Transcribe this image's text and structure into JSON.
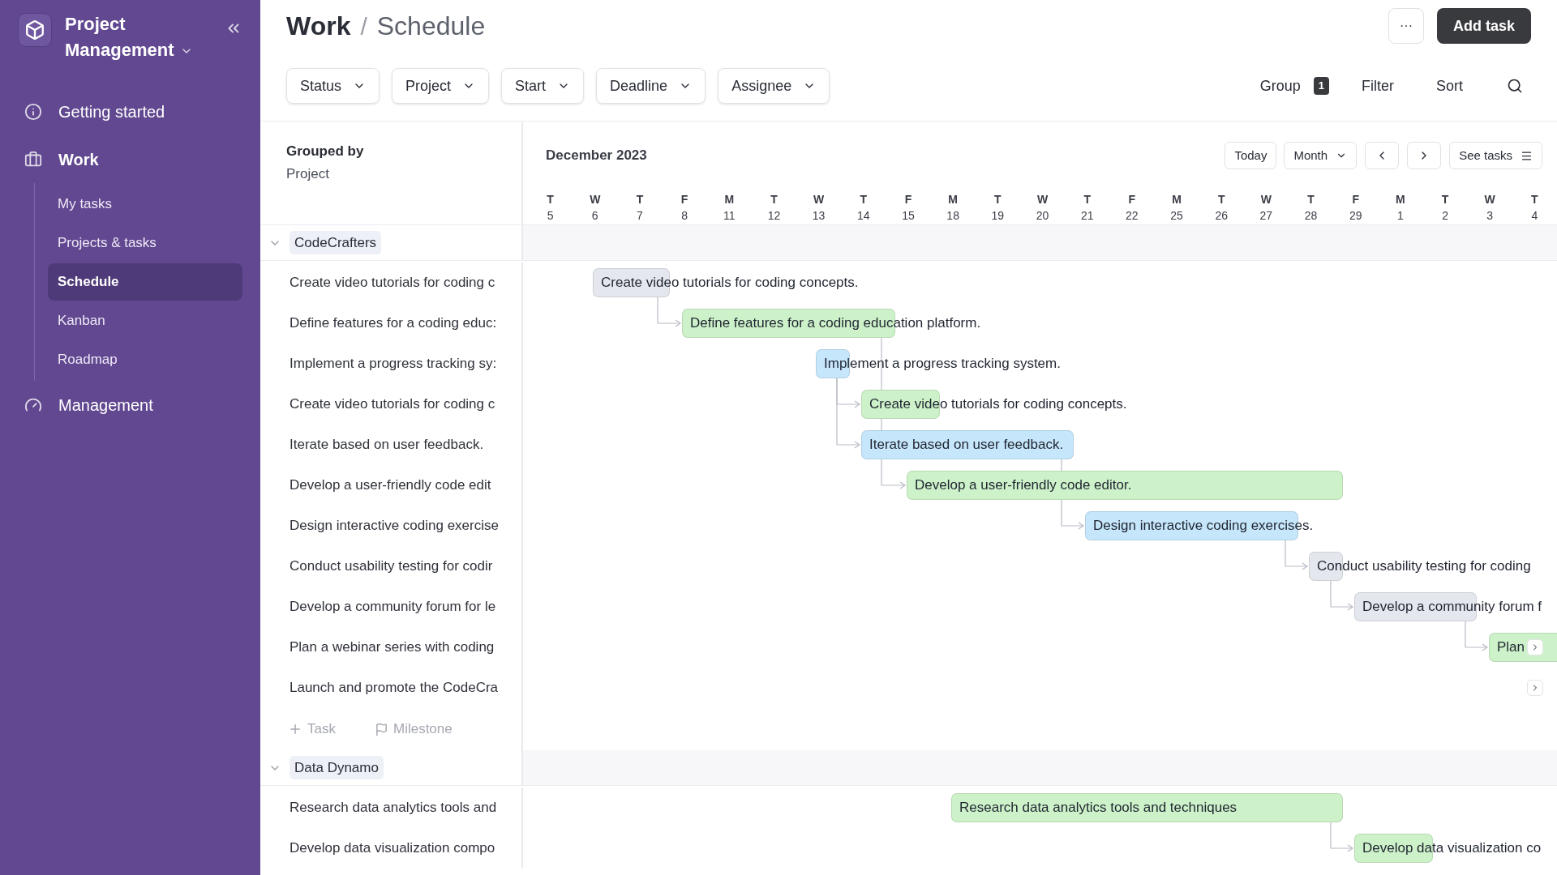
{
  "sidebar": {
    "workspace": "Project Management",
    "items": [
      {
        "label": "Getting started",
        "selected": false
      },
      {
        "label": "Work",
        "selected": false,
        "children": [
          {
            "label": "My tasks",
            "selected": false
          },
          {
            "label": "Projects & tasks",
            "selected": false
          },
          {
            "label": "Schedule",
            "selected": true
          },
          {
            "label": "Kanban",
            "selected": false
          },
          {
            "label": "Roadmap",
            "selected": false
          }
        ]
      },
      {
        "label": "Management",
        "selected": false
      }
    ]
  },
  "header": {
    "section": "Work",
    "separator": "/",
    "page": "Schedule",
    "more_button": "···",
    "add_button": "Add task"
  },
  "filters": [
    "Status",
    "Project",
    "Start",
    "Deadline",
    "Assignee"
  ],
  "toolbar": {
    "group_label": "Group",
    "group_count": "1",
    "filter": "Filter",
    "sort": "Sort"
  },
  "grouping": {
    "title": "Grouped by",
    "value": "Project"
  },
  "timeline": {
    "month": "December 2023",
    "today": "Today",
    "view": "Month",
    "see_tasks": "See tasks",
    "days": [
      {
        "weekday": "T",
        "date": "5"
      },
      {
        "weekday": "W",
        "date": "6"
      },
      {
        "weekday": "T",
        "date": "7"
      },
      {
        "weekday": "F",
        "date": "8"
      },
      {
        "weekday": "M",
        "date": "11"
      },
      {
        "weekday": "T",
        "date": "12"
      },
      {
        "weekday": "W",
        "date": "13"
      },
      {
        "weekday": "T",
        "date": "14"
      },
      {
        "weekday": "F",
        "date": "15"
      },
      {
        "weekday": "M",
        "date": "18"
      },
      {
        "weekday": "T",
        "date": "19"
      },
      {
        "weekday": "W",
        "date": "20"
      },
      {
        "weekday": "T",
        "date": "21"
      },
      {
        "weekday": "F",
        "date": "22"
      },
      {
        "weekday": "M",
        "date": "25"
      },
      {
        "weekday": "T",
        "date": "26"
      },
      {
        "weekday": "W",
        "date": "27"
      },
      {
        "weekday": "T",
        "date": "28"
      },
      {
        "weekday": "F",
        "date": "29"
      },
      {
        "weekday": "M",
        "date": "1"
      },
      {
        "weekday": "T",
        "date": "2"
      },
      {
        "weekday": "W",
        "date": "3"
      },
      {
        "weekday": "T",
        "date": "4"
      }
    ]
  },
  "groups": [
    {
      "name": "CodeCrafters",
      "expanded": true,
      "add_task": "Task",
      "add_milestone": "Milestone",
      "tasks": [
        {
          "name": "Create video tutorials for coding c",
          "bar": "Create video tutorials for coding concepts.",
          "color": "#e5e7ee",
          "more_arrow": false
        },
        {
          "name": "Define features for a coding educ:",
          "bar": "Define features for a coding education platform.",
          "color": "#cdf2c9",
          "more_arrow": false
        },
        {
          "name": "Implement a progress tracking sy:",
          "bar": "Implement a progress tracking system.",
          "color": "#c6e7fb",
          "more_arrow": false
        },
        {
          "name": "Create video tutorials for coding c",
          "bar": "Create video tutorials for coding concepts.",
          "color": "#cdf2c9",
          "more_arrow": false
        },
        {
          "name": "Iterate based on user feedback.",
          "bar": "Iterate based on user feedback.",
          "color": "#c6e7fb",
          "more_arrow": false
        },
        {
          "name": "Develop a user-friendly code edit",
          "bar": "Develop a user-friendly code editor.",
          "color": "#cdf2c9",
          "more_arrow": false
        },
        {
          "name": "Design interactive coding exercise",
          "bar": "Design interactive coding exercises.",
          "color": "#c6e7fb",
          "more_arrow": false
        },
        {
          "name": "Conduct usability testing for codir",
          "bar": "Conduct usability testing for coding",
          "color": "#e5e7ee",
          "more_arrow": false
        },
        {
          "name": "Develop a community forum for le",
          "bar": "Develop a community forum f",
          "color": "#e5e7ee",
          "more_arrow": false
        },
        {
          "name": "Plan a webinar series with coding",
          "bar": "Plan",
          "color": "#cdf2c9",
          "more_arrow": true
        },
        {
          "name": "Launch and promote the CodeCra",
          "more_arrow": true
        }
      ]
    },
    {
      "name": "Data Dynamo",
      "expanded": true,
      "tasks": [
        {
          "name": "Research data analytics tools and",
          "bar": "Research data analytics tools and techniques",
          "color": "#cdf2c9",
          "more_arrow": false
        },
        {
          "name": "Develop data visualization compo",
          "bar": "Develop data visualization co",
          "color": "#cdf2c9",
          "more_arrow": false
        }
      ]
    }
  ]
}
